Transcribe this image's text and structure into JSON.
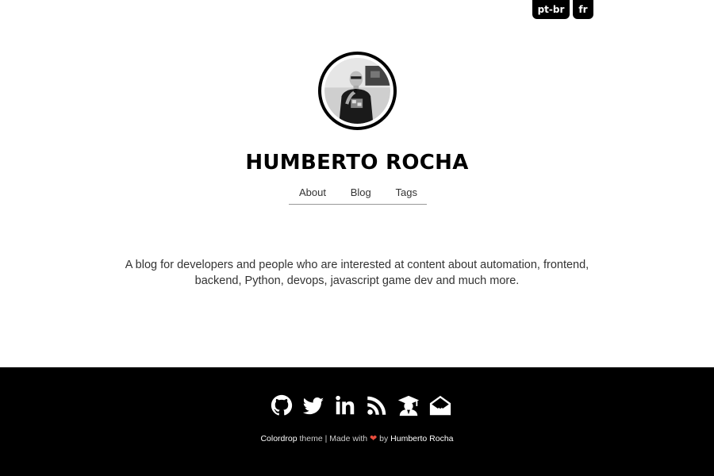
{
  "languages": [
    {
      "label": "pt-br"
    },
    {
      "label": "fr"
    }
  ],
  "site": {
    "title": "HUMBERTO ROCHA",
    "avatar_alt": "Humberto Rocha"
  },
  "nav": {
    "items": [
      {
        "label": "About"
      },
      {
        "label": "Blog"
      },
      {
        "label": "Tags"
      }
    ]
  },
  "description": "A blog for developers and people who are interested at content about automation, frontend, backend, Python, devops, javascript game dev and much more.",
  "footer": {
    "social_icons": [
      "github-icon",
      "twitter-icon",
      "linkedin-icon",
      "rss-icon",
      "graduation-icon",
      "email-icon"
    ],
    "credits": {
      "theme_name": "Colordrop",
      "theme_suffix": " theme | Made with ",
      "heart": "❤",
      "by": " by ",
      "author": "Humberto Rocha"
    },
    "heart_color": "#e74c3c",
    "background": "#000000"
  }
}
